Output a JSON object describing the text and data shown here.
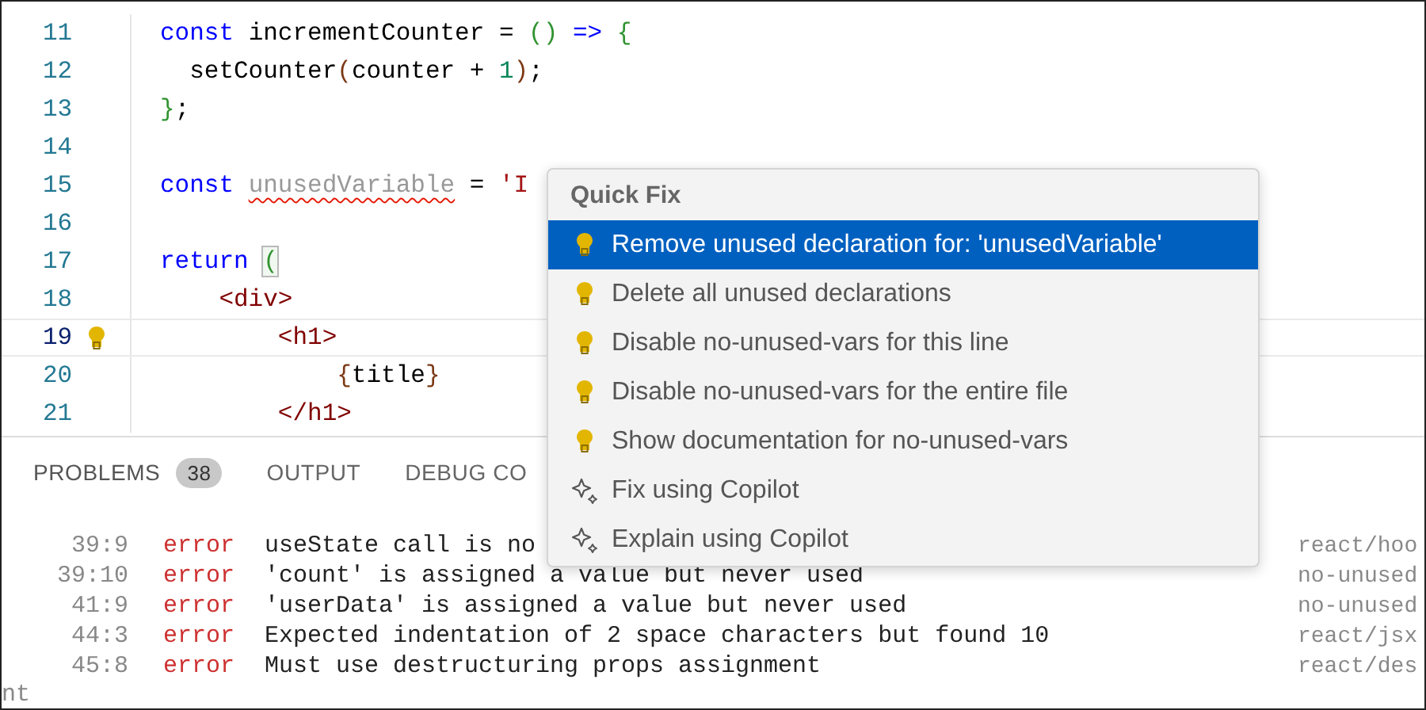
{
  "editor": {
    "lines": [
      {
        "number": "11",
        "current": false,
        "tokens": [
          {
            "kind": "keyword",
            "text": "const"
          },
          {
            "kind": "plain",
            "text": " incrementCounter = "
          },
          {
            "kind": "bracket",
            "text": "()"
          },
          {
            "kind": "keyword",
            "text": " =>"
          },
          {
            "kind": "bracket",
            "text": " {"
          }
        ]
      },
      {
        "number": "12",
        "current": false,
        "tokens": [
          {
            "kind": "plain",
            "text": "  setCounter"
          },
          {
            "kind": "paren",
            "text": "("
          },
          {
            "kind": "plain",
            "text": "counter + "
          },
          {
            "kind": "number",
            "text": "1"
          },
          {
            "kind": "paren",
            "text": ")"
          },
          {
            "kind": "plain",
            "text": ";"
          }
        ]
      },
      {
        "number": "13",
        "current": false,
        "tokens": [
          {
            "kind": "bracket",
            "text": "}"
          },
          {
            "kind": "plain",
            "text": ";"
          }
        ]
      },
      {
        "number": "14",
        "current": false
      },
      {
        "number": "15",
        "current": false,
        "tokens": [
          {
            "kind": "keyword",
            "text": "const "
          },
          {
            "kind": "unused",
            "text": "unusedVariable"
          },
          {
            "kind": "plain",
            "text": " = "
          },
          {
            "kind": "string",
            "text": "'I"
          }
        ]
      },
      {
        "number": "16",
        "current": false
      },
      {
        "number": "17",
        "current": false,
        "tokens": [
          {
            "kind": "keyword",
            "text": "return "
          },
          {
            "kind": "matched",
            "text": "("
          }
        ]
      },
      {
        "number": "18",
        "current": false,
        "tokens": [
          {
            "kind": "tag",
            "text": "    <div>"
          }
        ]
      },
      {
        "number": "19",
        "current": true,
        "tokens": [
          {
            "kind": "tag",
            "text": "        <h1>"
          }
        ]
      },
      {
        "number": "20",
        "current": false,
        "tokens": [
          {
            "kind": "paren",
            "text": "            {"
          },
          {
            "kind": "plain",
            "text": "title"
          },
          {
            "kind": "paren",
            "text": "}"
          }
        ]
      },
      {
        "number": "21",
        "current": false,
        "tokens": [
          {
            "kind": "tag",
            "text": "        </h1>"
          }
        ]
      }
    ]
  },
  "quick_fix": {
    "title": "Quick Fix",
    "items": [
      {
        "kind": "lightbulb",
        "label": "Remove unused declaration for: 'unusedVariable'",
        "selected": true
      },
      {
        "kind": "lightbulb",
        "label": "Delete all unused declarations",
        "selected": false
      },
      {
        "kind": "lightbulb",
        "label": "Disable no-unused-vars for this line",
        "selected": false
      },
      {
        "kind": "lightbulb",
        "label": "Disable no-unused-vars for the entire file",
        "selected": false
      },
      {
        "kind": "lightbulb",
        "label": "Show documentation for no-unused-vars",
        "selected": false
      },
      {
        "kind": "sparkle",
        "label": "Fix using Copilot",
        "selected": false
      },
      {
        "kind": "sparkle",
        "label": "Explain using Copilot",
        "selected": false
      }
    ]
  },
  "panel": {
    "tabs": [
      {
        "label": "PROBLEMS",
        "badge": "38",
        "selected": true
      },
      {
        "label": "OUTPUT",
        "selected": false
      },
      {
        "label": "DEBUG CO",
        "selected": false
      }
    ],
    "problems": [
      {
        "location": "39:9",
        "severity": "error",
        "message": "useState call is no",
        "source": "react/hoo"
      },
      {
        "location": "39:10",
        "severity": "error",
        "message": "'count' is assigned a value but never used",
        "source": "no-unused"
      },
      {
        "location": "41:9",
        "severity": "error",
        "message": "'userData' is assigned a value but never used",
        "source": "no-unused"
      },
      {
        "location": "44:3",
        "severity": "error",
        "message": "Expected indentation of 2 space characters but found 10",
        "source": "react/jsx"
      },
      {
        "location": "45:8",
        "severity": "error",
        "message": "Must use destructuring props assignment",
        "source": "react/des"
      }
    ],
    "trailing_text": "nt"
  }
}
